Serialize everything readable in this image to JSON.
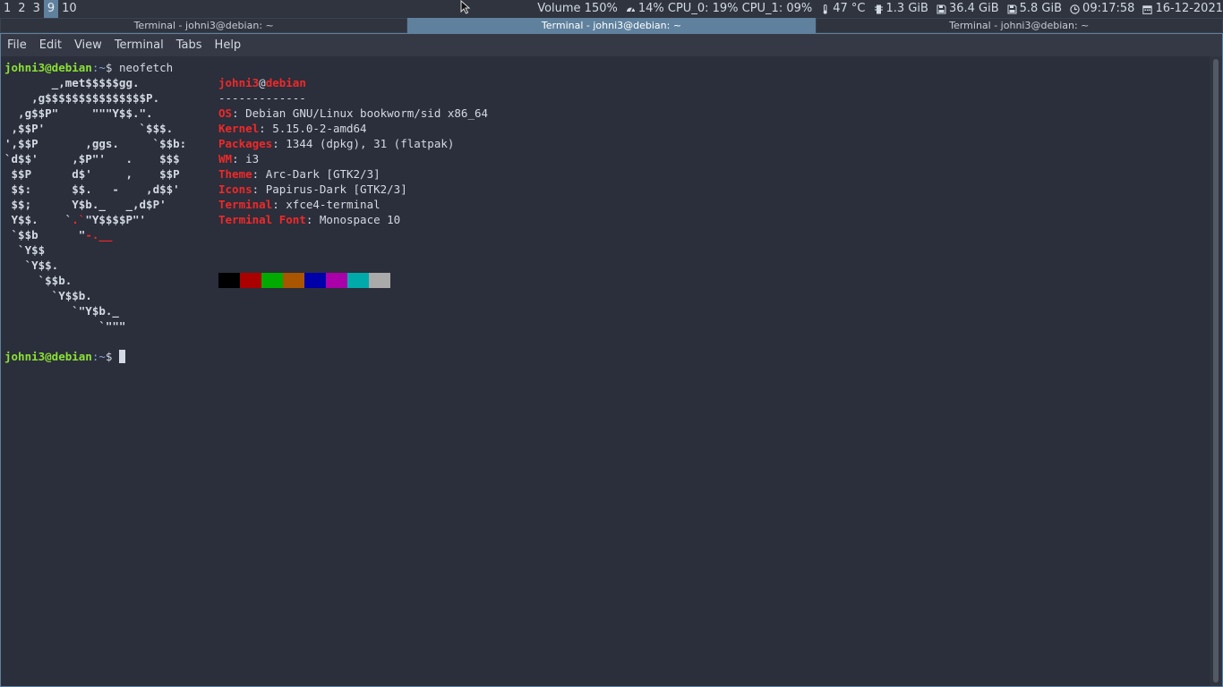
{
  "workspaces": [
    {
      "label": "1",
      "active": false
    },
    {
      "label": "2",
      "active": false
    },
    {
      "label": "3",
      "active": false
    },
    {
      "label": "9",
      "active": true
    },
    {
      "label": "10",
      "active": false
    }
  ],
  "status": {
    "volume": "Volume 150%",
    "cpu": "14% CPU_0: 19% CPU_1: 09%",
    "temp": "47 °C",
    "memory": "1.3 GiB",
    "disk1": "36.4 GiB",
    "disk2": "5.8 GiB",
    "time": "09:17:58",
    "date": "16-12-2021"
  },
  "tabs": [
    {
      "title": "Terminal - johni3@debian: ~",
      "focused": false
    },
    {
      "title": "Terminal - johni3@debian: ~",
      "focused": true
    },
    {
      "title": "Terminal - johni3@debian: ~",
      "focused": false
    }
  ],
  "menu": [
    "File",
    "Edit",
    "View",
    "Terminal",
    "Tabs",
    "Help"
  ],
  "terminal": {
    "prompt_user_host": "johni3@debian",
    "prompt_path": ":~",
    "prompt_symbol": "$",
    "command": "neofetch",
    "ascii_art": [
      "       _,met$$$$$gg.",
      "    ,g$$$$$$$$$$$$$$$P.",
      "  ,g$$P\"     \"\"\"Y$$.\".",
      " ,$$P'              `$$$.",
      "',$$P       ,ggs.     `$$b:",
      "`d$$'     ,$P\"'   .    $$$",
      " $$P      d$'     ,    $$P",
      " $$:      $$.   -    ,d$$'",
      " $$;      Y$b._   _,d$P'",
      " Y$$.    `.`\"Y$$$$P\"'",
      " `$$b      \"-.__",
      "  `Y$$",
      "   `Y$$.",
      "     `$$b.",
      "       `Y$$b.",
      "          `\"Y$b._",
      "              `\"\"\""
    ],
    "info": {
      "user": "johni3",
      "at": "@",
      "host": "debian",
      "separator": "-------------",
      "rows": [
        {
          "key": "OS",
          "value": ": Debian GNU/Linux bookworm/sid x86_64"
        },
        {
          "key": "Kernel",
          "value": ": 5.15.0-2-amd64"
        },
        {
          "key": "Packages",
          "value": ": 1344 (dpkg), 31 (flatpak)"
        },
        {
          "key": "WM",
          "value": ": i3"
        },
        {
          "key": "Theme",
          "value": ": Arc-Dark [GTK2/3]"
        },
        {
          "key": "Icons",
          "value": ": Papirus-Dark [GTK2/3]"
        },
        {
          "key": "Terminal",
          "value": ": xfce4-terminal"
        },
        {
          "key": "Terminal Font",
          "value": ": Monospace 10"
        }
      ]
    },
    "palette": [
      "#000000",
      "#aa0000",
      "#00aa00",
      "#aa5500",
      "#0000aa",
      "#aa00aa",
      "#00aaaa",
      "#aaaaaa"
    ]
  },
  "icons": {
    "cpu": "speedometer-icon",
    "temp": "thermometer-icon",
    "memory": "memory-chip-icon",
    "disk": "floppy-disk-icon",
    "clock": "clock-icon",
    "calendar": "calendar-icon"
  }
}
